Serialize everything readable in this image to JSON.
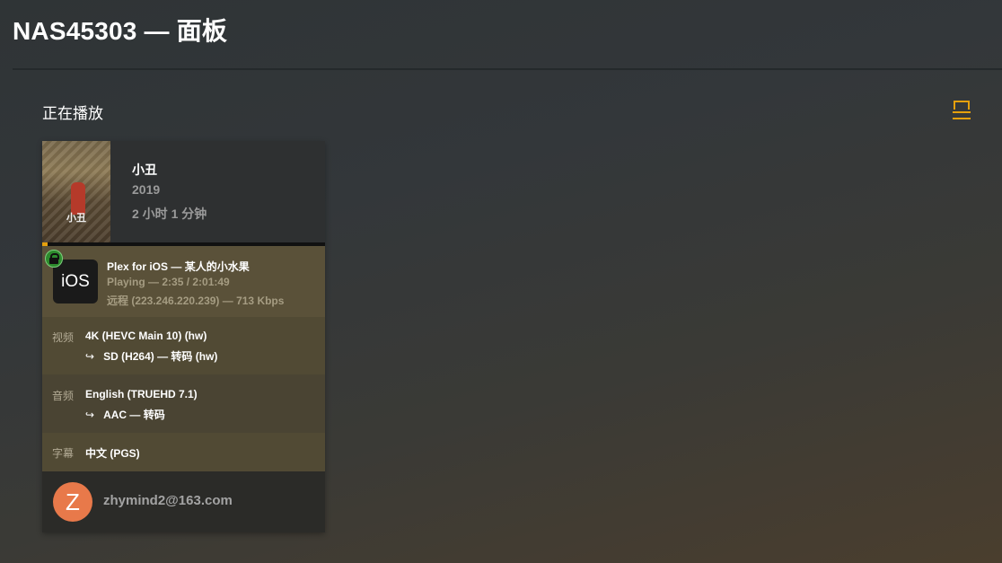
{
  "header": {
    "title": "NAS45303 — 面板"
  },
  "section": {
    "title": "正在播放",
    "view_icon": "list-view-icon",
    "accent": "#e5a00d"
  },
  "session": {
    "title": "小丑",
    "year": "2019",
    "duration": "2 小时 1 分钟",
    "poster_caption": "小丑",
    "progress_fraction": 0.02,
    "player": {
      "platform_icon_text": "iOS",
      "line1": "Plex for iOS  —  某人的小水果",
      "line2": "Playing — 2:35 / 2:01:49",
      "line3": "远程 (223.246.220.239) — 713 Kbps",
      "secure_icon": "lock-icon"
    },
    "video": {
      "label": "视频",
      "source": "4K (HEVC Main 10) (hw)",
      "arrow": "↪",
      "target": "SD (H264) — 转码 (hw)"
    },
    "audio": {
      "label": "音频",
      "source": "English (TRUEHD 7.1)",
      "arrow": "↪",
      "target": "AAC — 转码"
    },
    "subtitle": {
      "label": "字幕",
      "source": "中文 (PGS)"
    },
    "user": {
      "avatar_letter": "Z",
      "email": "zhymind2@163.com",
      "avatar_color": "#e8794a"
    }
  }
}
